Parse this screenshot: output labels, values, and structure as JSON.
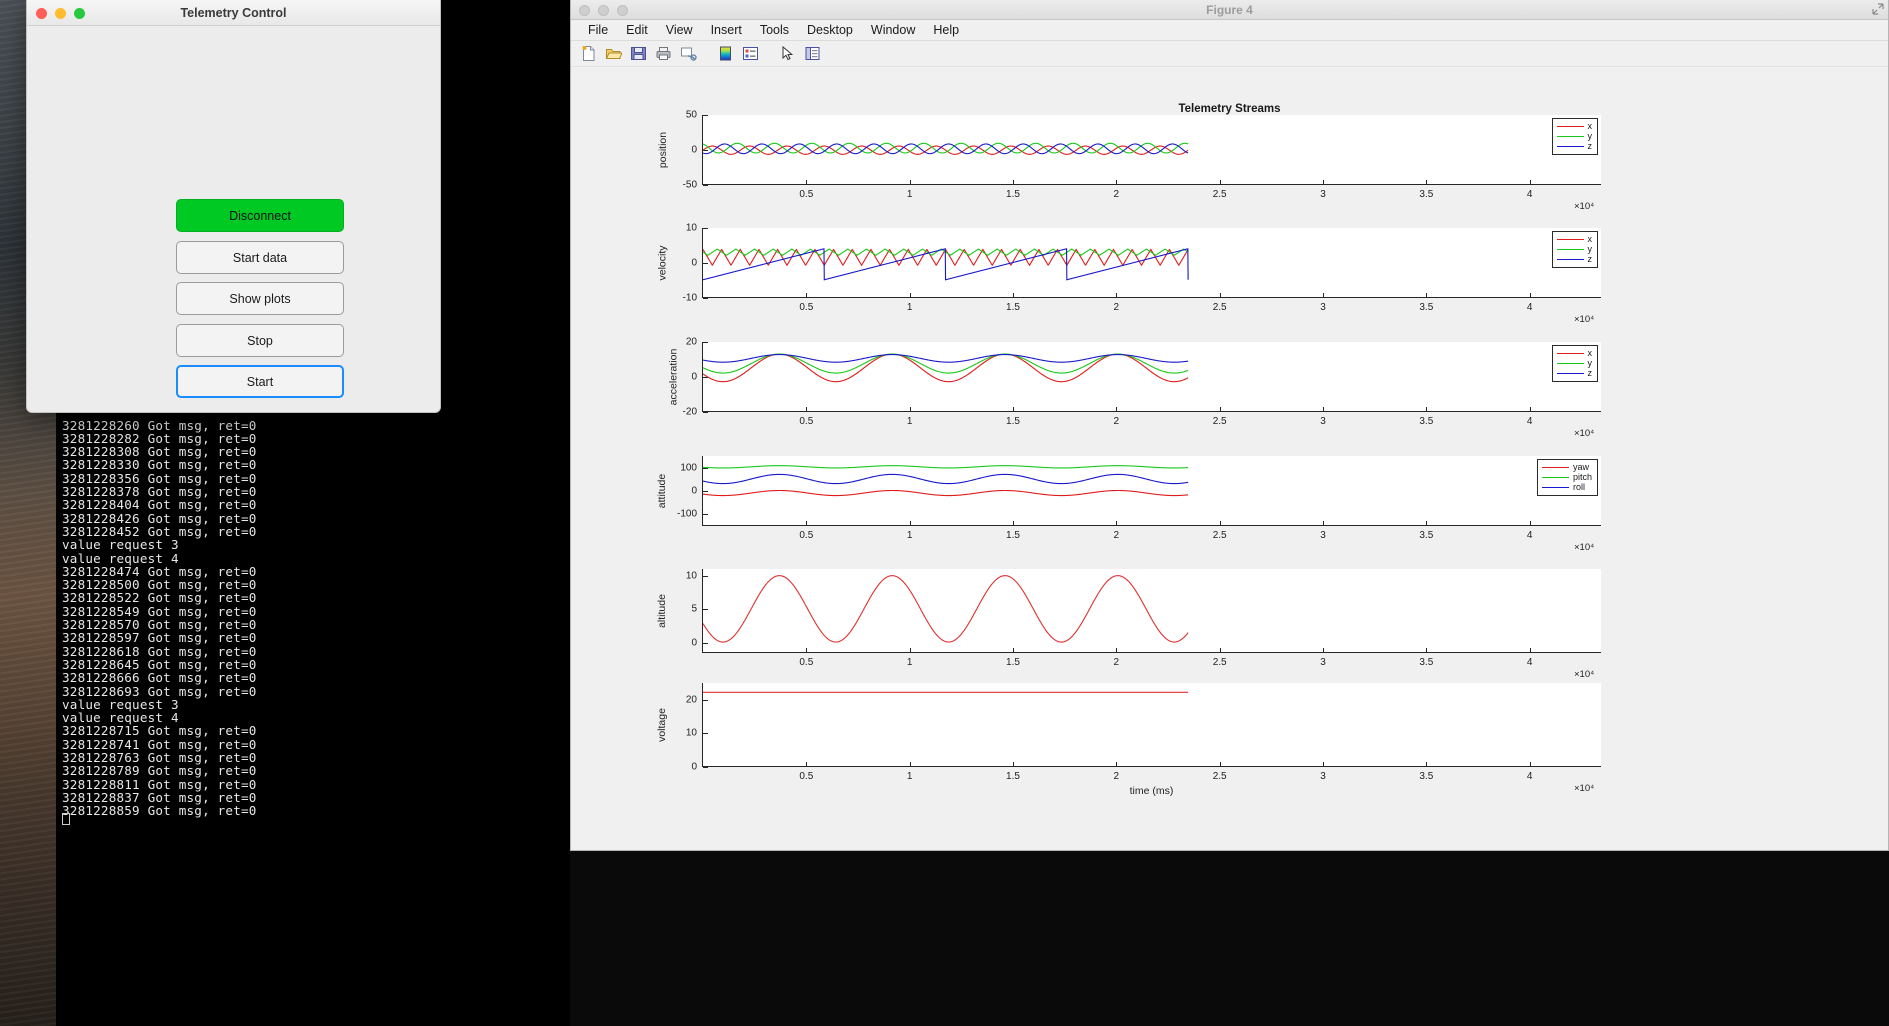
{
  "desktop": {
    "background_color": "#0a0a0a"
  },
  "mac_window": {
    "title": "Telemetry Control",
    "traffic_lights": [
      "close",
      "minimize",
      "zoom"
    ],
    "buttons": [
      {
        "label": "Disconnect",
        "style": "green"
      },
      {
        "label": "Start data",
        "style": "default"
      },
      {
        "label": "Show plots",
        "style": "default"
      },
      {
        "label": "Stop",
        "style": "default"
      },
      {
        "label": "Start",
        "style": "focused"
      }
    ],
    "accent_green": "#00c923",
    "focus_blue": "#1a8cff"
  },
  "terminal": {
    "lines": [
      "3281228260 Got msg, ret=0",
      "3281228282 Got msg, ret=0",
      "3281228308 Got msg, ret=0",
      "3281228330 Got msg, ret=0",
      "3281228356 Got msg, ret=0",
      "3281228378 Got msg, ret=0",
      "3281228404 Got msg, ret=0",
      "3281228426 Got msg, ret=0",
      "3281228452 Got msg, ret=0",
      "value request 3",
      "value request 4",
      "3281228474 Got msg, ret=0",
      "3281228500 Got msg, ret=0",
      "3281228522 Got msg, ret=0",
      "3281228549 Got msg, ret=0",
      "3281228570 Got msg, ret=0",
      "3281228597 Got msg, ret=0",
      "3281228618 Got msg, ret=0",
      "3281228645 Got msg, ret=0",
      "3281228666 Got msg, ret=0",
      "3281228693 Got msg, ret=0",
      "value request 3",
      "value request 4",
      "3281228715 Got msg, ret=0",
      "3281228741 Got msg, ret=0",
      "3281228763 Got msg, ret=0",
      "3281228789 Got msg, ret=0",
      "3281228811 Got msg, ret=0",
      "3281228837 Got msg, ret=0",
      "3281228859 Got msg, ret=0"
    ],
    "text": "3281228260 Got msg, ret=0\n3281228282 Got msg, ret=0\n3281228308 Got msg, ret=0\n3281228330 Got msg, ret=0\n3281228356 Got msg, ret=0\n3281228378 Got msg, ret=0\n3281228404 Got msg, ret=0\n3281228426 Got msg, ret=0\n3281228452 Got msg, ret=0\nvalue request 3\nvalue request 4\n3281228474 Got msg, ret=0\n3281228500 Got msg, ret=0\n3281228522 Got msg, ret=0\n3281228549 Got msg, ret=0\n3281228570 Got msg, ret=0\n3281228597 Got msg, ret=0\n3281228618 Got msg, ret=0\n3281228645 Got msg, ret=0\n3281228666 Got msg, ret=0\n3281228693 Got msg, ret=0\nvalue request 3\nvalue request 4\n3281228715 Got msg, ret=0\n3281228741 Got msg, ret=0\n3281228763 Got msg, ret=0\n3281228789 Got msg, ret=0\n3281228811 Got msg, ret=0\n3281228837 Got msg, ret=0\n3281228859 Got msg, ret=0"
  },
  "figure_window": {
    "title": "Figure 4",
    "menus": [
      "File",
      "Edit",
      "View",
      "Insert",
      "Tools",
      "Desktop",
      "Window",
      "Help"
    ],
    "toolbar_icons": [
      "new-figure-icon",
      "open-file-icon",
      "save-figure-icon",
      "print-figure-icon",
      "link-plot-icon",
      "colorbar-icon",
      "legend-icon",
      "pointer-icon",
      "plot-browser-icon"
    ]
  },
  "chart_data": [
    {
      "type": "line",
      "title": "Telemetry Streams",
      "ylabel": "position",
      "xlabel": "",
      "ylim": [
        -50,
        50
      ],
      "yticks": [
        -50,
        0,
        50
      ],
      "xlim": [
        0,
        4.35
      ],
      "xticks": [
        0.5,
        1,
        1.5,
        2,
        2.5,
        3,
        3.5,
        4
      ],
      "x_multiplier": "×10⁴",
      "data_x_end": 2.35,
      "legend": [
        {
          "name": "x",
          "color": "#e01b1b"
        },
        {
          "name": "y",
          "color": "#18c818"
        },
        {
          "name": "z",
          "color": "#1818cc"
        }
      ],
      "legend_position": "top-right",
      "series": [
        {
          "name": "x",
          "color": "#e01b1b",
          "waveform": "sine",
          "amplitude": 6,
          "offset": -1,
          "cycles": 13,
          "phase": 0.0
        },
        {
          "name": "y",
          "color": "#18c818",
          "waveform": "sine",
          "amplitude": 7,
          "offset": 2,
          "cycles": 13,
          "phase": 2.1
        },
        {
          "name": "z",
          "color": "#1818cc",
          "waveform": "sine",
          "amplitude": 7,
          "offset": 1,
          "cycles": 13,
          "phase": 4.2
        }
      ]
    },
    {
      "type": "line",
      "ylabel": "velocity",
      "ylim": [
        -10,
        10
      ],
      "yticks": [
        -10,
        0,
        10
      ],
      "xlim": [
        0,
        4.35
      ],
      "xticks": [
        0.5,
        1,
        1.5,
        2,
        2.5,
        3,
        3.5,
        4
      ],
      "x_multiplier": "×10⁴",
      "data_x_end": 2.35,
      "legend": [
        {
          "name": "x",
          "color": "#e01b1b"
        },
        {
          "name": "y",
          "color": "#18c818"
        },
        {
          "name": "z",
          "color": "#1818cc"
        }
      ],
      "legend_position": "top-right",
      "series": [
        {
          "name": "x",
          "color": "#e01b1b",
          "waveform": "triangle",
          "amplitude": 2.3,
          "offset": 1.5,
          "cycles": 26,
          "phase": 0.0
        },
        {
          "name": "y",
          "color": "#18c818",
          "waveform": "triangle",
          "amplitude": 0.9,
          "offset": 3.0,
          "cycles": 26,
          "phase": 1.5
        },
        {
          "name": "z",
          "color": "#1818cc",
          "waveform": "sawtooth",
          "amplitude": 4.5,
          "offset": -0.5,
          "cycles": 4,
          "phase": 0.0
        }
      ]
    },
    {
      "type": "line",
      "ylabel": "acceleration",
      "ylim": [
        -20,
        20
      ],
      "yticks": [
        -20,
        0,
        20
      ],
      "xlim": [
        0,
        4.35
      ],
      "xticks": [
        0.5,
        1,
        1.5,
        2,
        2.5,
        3,
        3.5,
        4
      ],
      "x_multiplier": "×10⁴",
      "data_x_end": 2.35,
      "legend": [
        {
          "name": "x",
          "color": "#e01b1b"
        },
        {
          "name": "y",
          "color": "#18c818"
        },
        {
          "name": "z",
          "color": "#1818cc"
        }
      ],
      "legend_position": "top-right",
      "series": [
        {
          "name": "x",
          "color": "#e01b1b",
          "waveform": "sine",
          "amplitude": 8,
          "offset": 5,
          "cycles": 4.3,
          "phase": 3.6
        },
        {
          "name": "y",
          "color": "#18c818",
          "waveform": "sine",
          "amplitude": 5.5,
          "offset": 7.5,
          "cycles": 4.3,
          "phase": 3.6
        },
        {
          "name": "z",
          "color": "#1818cc",
          "waveform": "sine",
          "amplitude": 2.2,
          "offset": 10.5,
          "cycles": 4.3,
          "phase": 3.6
        }
      ]
    },
    {
      "type": "line",
      "ylabel": "attitude",
      "ylim": [
        -150,
        150
      ],
      "yticks": [
        -100,
        0,
        100
      ],
      "xlim": [
        0,
        4.35
      ],
      "xticks": [
        0.5,
        1,
        1.5,
        2,
        2.5,
        3,
        3.5,
        4
      ],
      "x_multiplier": "×10⁴",
      "data_x_end": 2.35,
      "legend": [
        {
          "name": "yaw",
          "color": "#e01b1b"
        },
        {
          "name": "pitch",
          "color": "#18c818"
        },
        {
          "name": "roll",
          "color": "#1818cc"
        }
      ],
      "legend_position": "top-right",
      "series": [
        {
          "name": "yaw",
          "color": "#e01b1b",
          "waveform": "sine",
          "amplitude": 11,
          "offset": -11,
          "cycles": 4.3,
          "phase": 3.6
        },
        {
          "name": "pitch",
          "color": "#18c818",
          "waveform": "sine",
          "amplitude": 5,
          "offset": 103,
          "cycles": 4.3,
          "phase": 3.6
        },
        {
          "name": "roll",
          "color": "#1818cc",
          "waveform": "sine",
          "amplitude": 20,
          "offset": 50,
          "cycles": 4.3,
          "phase": 3.6
        }
      ]
    },
    {
      "type": "line",
      "ylabel": "altitude",
      "ylim": [
        -1.5,
        11
      ],
      "yticks": [
        0,
        5,
        10
      ],
      "xlim": [
        0,
        4.35
      ],
      "xticks": [
        0.5,
        1,
        1.5,
        2,
        2.5,
        3,
        3.5,
        4
      ],
      "x_multiplier": "×10⁴",
      "data_x_end": 2.35,
      "series": [
        {
          "name": "altitude",
          "color": "#e03030",
          "waveform": "sine",
          "amplitude": 5,
          "offset": 5,
          "cycles": 4.3,
          "phase": 3.6
        }
      ]
    },
    {
      "type": "line",
      "ylabel": "voltage",
      "xlabel": "time (ms)",
      "ylim": [
        0,
        25
      ],
      "yticks": [
        0,
        10,
        20
      ],
      "xlim": [
        0,
        4.35
      ],
      "xticks": [
        0.5,
        1,
        1.5,
        2,
        2.5,
        3,
        3.5,
        4
      ],
      "x_multiplier": "×10⁴",
      "data_x_end": 2.35,
      "series": [
        {
          "name": "voltage",
          "color": "#e03030",
          "waveform": "constant",
          "amplitude": 0,
          "offset": 22.2,
          "cycles": 1,
          "phase": 0
        }
      ]
    }
  ]
}
